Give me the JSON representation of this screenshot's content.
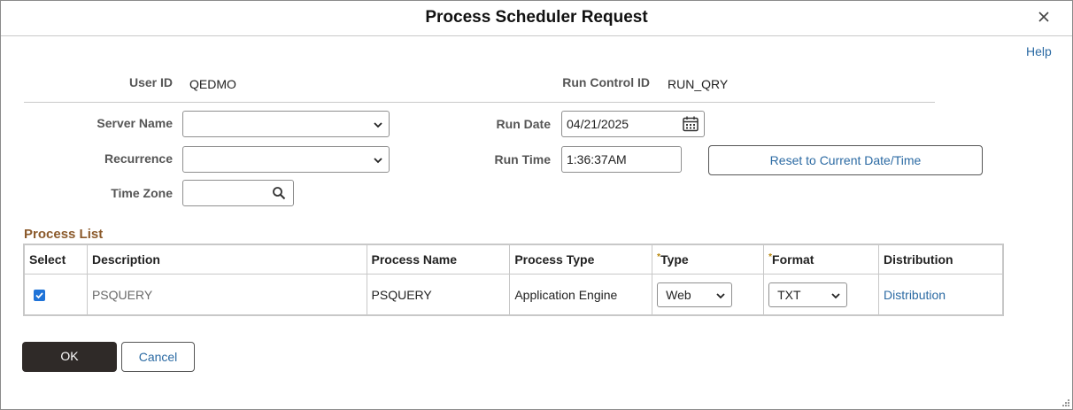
{
  "dialog": {
    "title": "Process Scheduler Request",
    "help_label": "Help"
  },
  "header": {
    "user_id_label": "User ID",
    "user_id_value": "QEDMO",
    "run_control_label": "Run Control ID",
    "run_control_value": "RUN_QRY"
  },
  "form": {
    "server_name_label": "Server Name",
    "server_name_value": "",
    "recurrence_label": "Recurrence",
    "recurrence_value": "",
    "time_zone_label": "Time Zone",
    "time_zone_value": "",
    "run_date_label": "Run Date",
    "run_date_value": "04/21/2025",
    "run_time_label": "Run Time",
    "run_time_value": "1:36:37AM",
    "reset_button_label": "Reset to Current Date/Time"
  },
  "process_list": {
    "title": "Process List",
    "columns": {
      "select": "Select",
      "description": "Description",
      "process_name": "Process Name",
      "process_type": "Process Type",
      "type": "Type",
      "format": "Format",
      "distribution": "Distribution"
    },
    "required_marker": "*",
    "rows": [
      {
        "selected": true,
        "description": "PSQUERY",
        "process_name": "PSQUERY",
        "process_type": "Application Engine",
        "type": "Web",
        "format": "TXT",
        "distribution": "Distribution"
      }
    ]
  },
  "actions": {
    "ok_label": "OK",
    "cancel_label": "Cancel"
  },
  "colors": {
    "primary_button": "#2f2a28",
    "link": "#2b6aa3",
    "section_title": "#8b5a2b",
    "checkbox": "#1f73d8",
    "required": "#b8860b"
  },
  "icons": {
    "close": "close-icon",
    "calendar": "calendar-icon",
    "search": "search-icon",
    "dropdown": "chevron-down-icon",
    "checkmark": "checkmark-icon",
    "resize": "resize-grip-icon"
  }
}
